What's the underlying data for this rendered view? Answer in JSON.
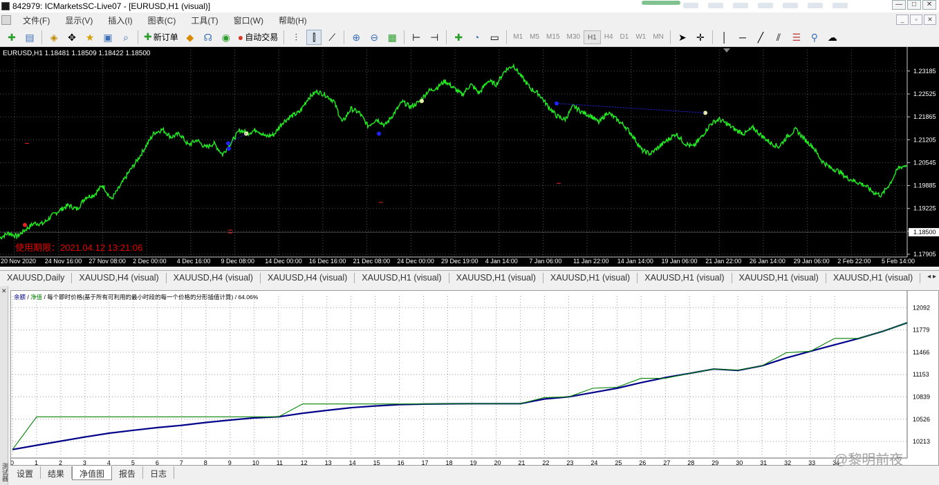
{
  "window": {
    "title": "842979: ICMarketsSC-Live07 - [EURUSD,H1 (visual)]",
    "buttons": [
      "—",
      "□",
      "✕"
    ],
    "mdi_buttons": [
      "_",
      "▫",
      "✕"
    ]
  },
  "menu": [
    "文件(F)",
    "显示(V)",
    "插入(I)",
    "图表(C)",
    "工具(T)",
    "窗口(W)",
    "帮助(H)"
  ],
  "toolbar": {
    "new_order_label": "新订单",
    "auto_trade_label": "自动交易",
    "timeframes": [
      "M1",
      "M5",
      "M15",
      "M30",
      "H1",
      "H4",
      "D1",
      "W1",
      "MN"
    ],
    "active_timeframe": "H1"
  },
  "chart": {
    "info": "EURUSD,H1  1.18481 1.18509 1.18422 1.18500",
    "expiry_text": "使用期限：2021.04.12 13:21:06",
    "current_price": "1.18500",
    "price_ticks": [
      "1.23185",
      "1.22525",
      "1.21865",
      "1.21205",
      "1.20545",
      "1.19885",
      "1.19225",
      "1.18565",
      "1.17905"
    ],
    "time_ticks": [
      "20 Nov 2020",
      "24 Nov 16:00",
      "27 Nov 08:00",
      "2 Dec 00:00",
      "4 Dec 16:00",
      "9 Dec 08:00",
      "14 Dec 00:00",
      "16 Dec 16:00",
      "21 Dec 08:00",
      "24 Dec 00:00",
      "29 Dec 19:00",
      "4 Jan 14:00",
      "7 Jan 06:00",
      "11 Jan 22:00",
      "14 Jan 14:00",
      "19 Jan 06:00",
      "21 Jan 22:00",
      "26 Jan 14:00",
      "29 Jan 06:00",
      "2 Feb 22:00",
      "5 Feb 14:00"
    ],
    "colors": {
      "price": "#22ee22",
      "grid": "#555555",
      "background": "#000000",
      "axis_text": "#ffffff",
      "expiry": "#e60000"
    },
    "chart_data": {
      "type": "line",
      "y_range": [
        1.17905,
        1.2352
      ],
      "close_path": [
        1.1838,
        1.1852,
        1.1842,
        1.1862,
        1.188,
        1.1878,
        1.19,
        1.1918,
        1.1932,
        1.192,
        1.1955,
        1.1962,
        1.199,
        1.1948,
        1.1985,
        1.2025,
        1.206,
        1.21,
        1.214,
        1.215,
        1.2128,
        1.2138,
        1.2105,
        1.212,
        1.2098,
        1.211,
        1.2078,
        1.2112,
        1.2148,
        1.214,
        1.215,
        1.213,
        1.2135,
        1.217,
        1.2188,
        1.22,
        1.224,
        1.226,
        1.225,
        1.2232,
        1.217,
        1.221,
        1.2198,
        1.216,
        1.218,
        1.2162,
        1.2195,
        1.223,
        1.2215,
        1.223,
        1.226,
        1.227,
        1.229,
        1.227,
        1.225,
        1.228,
        1.2255,
        1.229,
        1.228,
        1.232,
        1.2335,
        1.23,
        1.2268,
        1.2252,
        1.2218,
        1.219,
        1.2178,
        1.2218,
        1.22,
        1.219,
        1.217,
        1.22,
        1.218,
        1.216,
        1.213,
        1.209,
        1.208,
        1.21,
        1.212,
        1.2138,
        1.211,
        1.21,
        1.213,
        1.2165,
        1.218,
        1.2165,
        1.2148,
        1.2138,
        1.2155,
        1.2132,
        1.2112,
        1.21,
        1.213,
        1.215,
        1.2122,
        1.21,
        1.206,
        1.204,
        1.203,
        1.201,
        1.2,
        1.199,
        1.197,
        1.196,
        1.1995,
        1.204,
        1.2048
      ]
    }
  },
  "chart_tabs": [
    "XAUUSD,Daily",
    "XAUUSD,H4 (visual)",
    "XAUUSD,H4 (visual)",
    "XAUUSD,H4 (visual)",
    "XAUUSD,H1 (visual)",
    "XAUUSD,H1 (visual)",
    "XAUUSD,H1 (visual)",
    "XAUUSD,H1 (visual)",
    "XAUUSD,H1 (visual)",
    "XAUUSD,H1 (visual)"
  ],
  "tester": {
    "side_label": "测试器",
    "legend_balance": "余额",
    "legend_equity": "净值",
    "legend_rest": " / 每个即时价格(基于所有可利用的最小时段的每一个价格的分形插值计算) / 64.06%",
    "y_ticks": [
      "12092",
      "11779",
      "11466",
      "11153",
      "10839",
      "10526",
      "10213"
    ],
    "x_ticks": [
      "0",
      "1",
      "2",
      "3",
      "4",
      "5",
      "6",
      "7",
      "8",
      "9",
      "10",
      "11",
      "12",
      "13",
      "14",
      "15",
      "16",
      "17",
      "18",
      "19",
      "20",
      "21",
      "22",
      "23",
      "24",
      "25",
      "26",
      "27",
      "28",
      "29",
      "30",
      "31",
      "32",
      "33",
      "34"
    ],
    "watermark": "@黎明前夜",
    "tabs": [
      "设置",
      "结果",
      "净值图",
      "报告",
      "日志"
    ],
    "active_tab": "净值图",
    "colors": {
      "balance": "#00008b",
      "equity": "#008000"
    },
    "chart_data": {
      "type": "line",
      "y_range": [
        10000,
        12250
      ],
      "x_range": [
        0,
        37
      ],
      "series": [
        {
          "name": "余额",
          "x": [
            0,
            1,
            2,
            3,
            4,
            5,
            6,
            7,
            8,
            9,
            10,
            11,
            12,
            13,
            14,
            15,
            16,
            17,
            18,
            19,
            20,
            21,
            22,
            23,
            24,
            25,
            26,
            27,
            28,
            29,
            30,
            31,
            32,
            33,
            34,
            35,
            36,
            37
          ],
          "values": [
            10100,
            10160,
            10218,
            10276,
            10330,
            10370,
            10408,
            10440,
            10480,
            10514,
            10544,
            10560,
            10610,
            10650,
            10688,
            10712,
            10730,
            10738,
            10742,
            10744,
            10744,
            10744,
            10810,
            10840,
            10900,
            10960,
            11040,
            11110,
            11170,
            11230,
            11210,
            11276,
            11386,
            11480,
            11570,
            11660,
            11760,
            11880
          ]
        },
        {
          "name": "净值",
          "x": [
            0,
            1,
            2,
            3,
            4,
            5,
            6,
            7,
            8,
            9,
            10,
            11,
            12,
            13,
            14,
            15,
            16,
            17,
            18,
            19,
            20,
            21,
            22,
            23,
            24,
            25,
            26,
            27,
            28,
            29,
            30,
            31,
            32,
            33,
            34,
            35,
            36,
            37
          ],
          "values": [
            10100,
            10560,
            10560,
            10560,
            10560,
            10560,
            10560,
            10560,
            10560,
            10560,
            10560,
            10560,
            10740,
            10740,
            10740,
            10740,
            10740,
            10740,
            10744,
            10744,
            10744,
            10744,
            10830,
            10840,
            10960,
            10975,
            11100,
            11100,
            11170,
            11230,
            11215,
            11276,
            11460,
            11480,
            11660,
            11660,
            11760,
            11880
          ]
        }
      ]
    }
  }
}
